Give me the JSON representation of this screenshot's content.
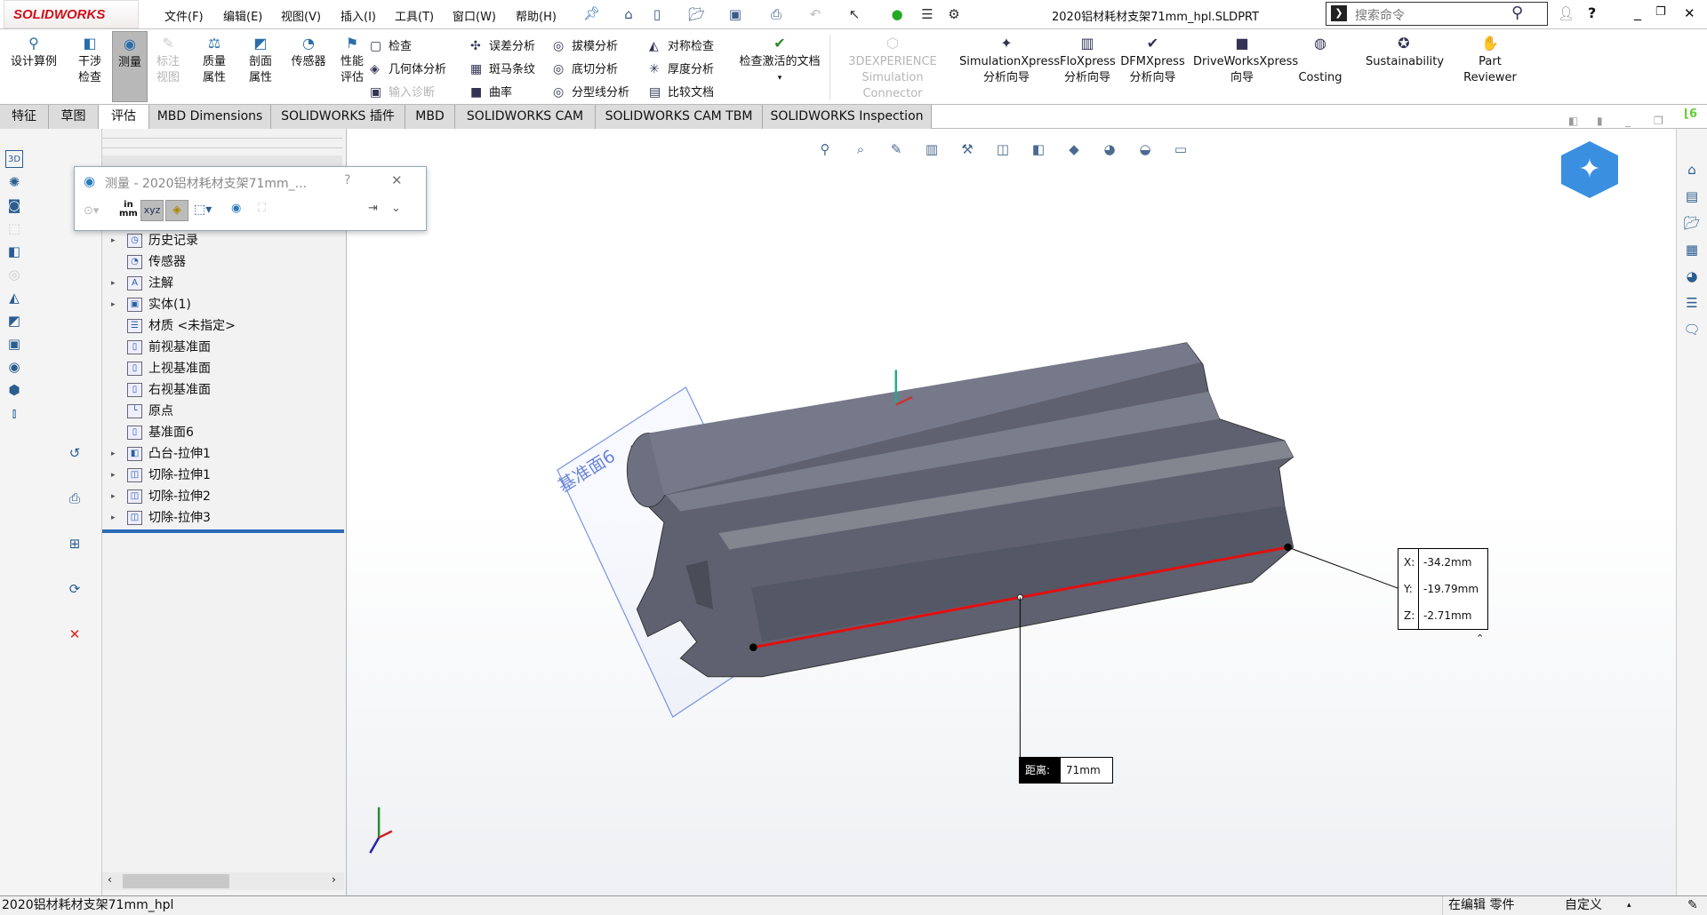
{
  "app": {
    "logo": "SOLIDWORKS",
    "document_title": "2020铝材耗材支架71mm_hpl.SLDPRT"
  },
  "menu": [
    "文件(F)",
    "编辑(E)",
    "视图(V)",
    "插入(I)",
    "工具(T)",
    "窗口(W)",
    "帮助(H)"
  ],
  "search": {
    "placeholder": "搜索命令"
  },
  "ribbon": {
    "big": [
      {
        "label": "设计算例",
        "icon": "design-study-icon",
        "enabled": true
      },
      {
        "label": "干涉检查",
        "icon": "interference-icon",
        "enabled": true
      },
      {
        "label": "测量",
        "icon": "measure-icon",
        "enabled": true,
        "active": true
      },
      {
        "label": "标注视图",
        "icon": "annotation-view-icon",
        "enabled": false
      },
      {
        "label": "质量属性",
        "icon": "mass-properties-icon",
        "enabled": true
      },
      {
        "label": "剖面属性",
        "icon": "section-properties-icon",
        "enabled": true
      },
      {
        "label": "传感器",
        "icon": "sensor-icon",
        "enabled": true
      },
      {
        "label": "性能评估",
        "icon": "performance-icon",
        "enabled": true
      }
    ],
    "small": [
      [
        {
          "label": "检查",
          "enabled": true
        },
        {
          "label": "几何体分析",
          "enabled": true
        },
        {
          "label": "输入诊断",
          "enabled": false
        }
      ],
      [
        {
          "label": "误差分析",
          "enabled": true
        },
        {
          "label": "斑马条纹",
          "enabled": true
        },
        {
          "label": "曲率",
          "enabled": true
        }
      ],
      [
        {
          "label": "拔模分析",
          "enabled": true
        },
        {
          "label": "底切分析",
          "enabled": true
        },
        {
          "label": "分型线分析",
          "enabled": true
        }
      ],
      [
        {
          "label": "对称检查",
          "enabled": true
        },
        {
          "label": "厚度分析",
          "enabled": true
        },
        {
          "label": "比较文档",
          "enabled": true
        }
      ]
    ],
    "check_active": "检查激活的文档",
    "addins": [
      {
        "label": "3DEXPERIENCE",
        "label2": "Simulation Connector",
        "enabled": false
      },
      {
        "label": "SimulationXpress",
        "label2": "分析向导",
        "enabled": true
      },
      {
        "label": "FloXpress",
        "label2": "分析向导",
        "enabled": true
      },
      {
        "label": "DFMXpress",
        "label2": "分析向导",
        "enabled": true
      },
      {
        "label": "DriveWorksXpress",
        "label2": "向导",
        "enabled": true
      },
      {
        "label": "",
        "label2": "Costing",
        "enabled": true
      },
      {
        "label": "Sustainability",
        "label2": "",
        "enabled": true
      },
      {
        "label": "Part",
        "label2": "Reviewer",
        "enabled": true
      }
    ]
  },
  "tabs": [
    "特征",
    "草图",
    "评估",
    "MBD Dimensions",
    "SOLIDWORKS 插件",
    "MBD",
    "SOLIDWORKS CAM",
    "SOLIDWORKS CAM TBM",
    "SOLIDWORKS Inspection"
  ],
  "active_tab": "评估",
  "measure_dialog": {
    "title": "测量 - 2020铝材耗材支架71mm_...",
    "help": "?",
    "units_label_top": "in",
    "units_label_bottom": "mm"
  },
  "tree": [
    {
      "label": "历史记录",
      "expand": true,
      "icon": "history-folder-icon"
    },
    {
      "label": "传感器",
      "expand": false,
      "icon": "sensor-folder-icon"
    },
    {
      "label": "注解",
      "expand": true,
      "icon": "annotations-folder-icon"
    },
    {
      "label": "实体(1)",
      "expand": true,
      "icon": "solid-bodies-icon"
    },
    {
      "label": "材质 <未指定>",
      "expand": false,
      "icon": "material-icon"
    },
    {
      "label": "前视基准面",
      "expand": false,
      "icon": "plane-icon"
    },
    {
      "label": "上视基准面",
      "expand": false,
      "icon": "plane-icon"
    },
    {
      "label": "右视基准面",
      "expand": false,
      "icon": "plane-icon"
    },
    {
      "label": "原点",
      "expand": false,
      "icon": "origin-icon"
    },
    {
      "label": "基准面6",
      "expand": false,
      "icon": "plane-icon"
    },
    {
      "label": "凸台-拉伸1",
      "expand": true,
      "icon": "boss-extrude-icon"
    },
    {
      "label": "切除-拉伸1",
      "expand": true,
      "icon": "cut-extrude-icon"
    },
    {
      "label": "切除-拉伸2",
      "expand": true,
      "icon": "cut-extrude-icon"
    },
    {
      "label": "切除-拉伸3",
      "expand": true,
      "icon": "cut-extrude-icon"
    }
  ],
  "viewport": {
    "plane_label": "基准面6",
    "coords": {
      "x_label": "X:",
      "x": "-34.2mm",
      "y_label": "Y:",
      "y": "-19.79mm",
      "z_label": "Z:",
      "z": "-2.71mm"
    },
    "distance": {
      "label": "距离:",
      "value": "71mm"
    },
    "measure_color": "#e01010",
    "part_color": "#5f6170"
  },
  "status": {
    "left": "2020铝材耗材支架71mm_hpl",
    "mode": "在编辑 零件",
    "custom": "自定义"
  }
}
